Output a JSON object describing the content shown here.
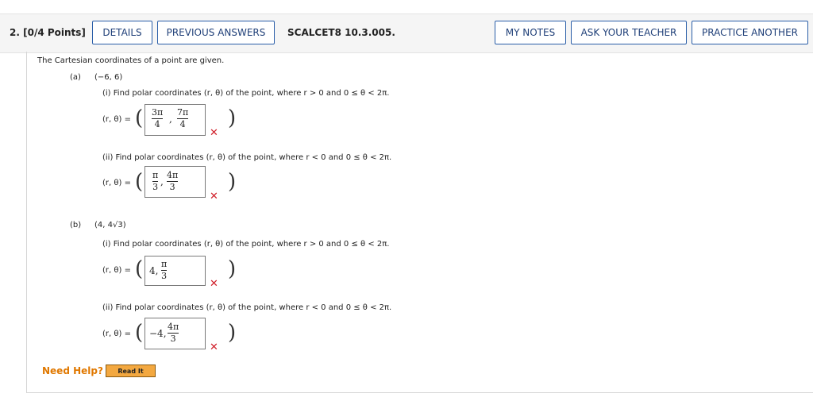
{
  "header": {
    "question_number": "2.",
    "points": "[0/4 Points]",
    "details_label": "DETAILS",
    "previous_answers_label": "PREVIOUS ANSWERS",
    "problem_code": "SCALCET8 10.3.005.",
    "my_notes_label": "MY NOTES",
    "ask_teacher_label": "ASK YOUR TEACHER",
    "practice_another_label": "PRACTICE ANOTHER"
  },
  "problem": {
    "intro": "The Cartesian coordinates of a point are given.",
    "part_a": {
      "label": "(a)",
      "point": "(−6, 6)",
      "q1": "(i) Find polar coordinates  (r, θ)  of the point, where  r > 0  and  0 ≤ θ < 2π.",
      "q2": "(ii) Find polar coordinates  (r, θ)  of the point, where  r < 0  and  0 ≤ θ < 2π.",
      "lhs": "(r, θ) =",
      "ans1": {
        "n1": "3π",
        "d1": "4",
        "n2": "7π",
        "d2": "4"
      },
      "ans2": {
        "n1": "π",
        "d1": "3",
        "n2": "4π",
        "d2": "3"
      }
    },
    "part_b": {
      "label": "(b)",
      "point": "(4, 4√3)",
      "q1": "(i) Find polar coordinates  (r, θ)  of the point, where  r > 0  and  0 ≤ θ < 2π.",
      "q2": "(ii) Find polar coordinates  (r, θ)  of the point, where  r < 0  and  0 ≤ θ < 2π.",
      "lhs": "(r, θ) =",
      "ans1": {
        "a": "4,",
        "n": "π",
        "d": "3"
      },
      "ans2": {
        "a": "−4,",
        "n": "4π",
        "d": "3"
      }
    },
    "incorrect_mark": "✕"
  },
  "help": {
    "need_help": "Need Help?",
    "read_it": "Read It"
  },
  "colors": {
    "button_border": "#2a5ea8",
    "incorrect": "#d0202a",
    "need_help": "#e07800",
    "read_it_bg": "#f3a840"
  }
}
